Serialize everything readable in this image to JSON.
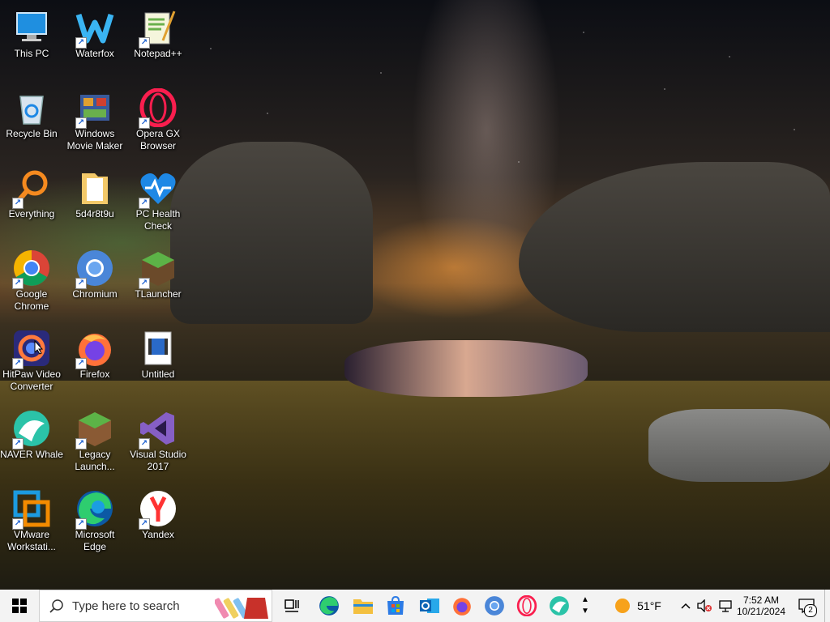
{
  "desktop": {
    "icons": [
      {
        "label": "This PC",
        "icon": "this-pc-icon",
        "shortcut": false
      },
      {
        "label": "Waterfox",
        "icon": "waterfox-icon",
        "shortcut": true
      },
      {
        "label": "Notepad++",
        "icon": "notepad-plus-plus-icon",
        "shortcut": true
      },
      {
        "label": "Recycle Bin",
        "icon": "recycle-bin-icon",
        "shortcut": false
      },
      {
        "label": "Windows Movie Maker",
        "icon": "movie-maker-icon",
        "shortcut": true
      },
      {
        "label": "Opera GX Browser",
        "icon": "opera-gx-icon",
        "shortcut": true
      },
      {
        "label": "Everything",
        "icon": "everything-search-icon",
        "shortcut": true
      },
      {
        "label": "5d4r8t9u",
        "icon": "folder-icon",
        "shortcut": false
      },
      {
        "label": "PC Health Check",
        "icon": "pc-health-check-icon",
        "shortcut": true
      },
      {
        "label": "Google Chrome",
        "icon": "chrome-icon",
        "shortcut": true
      },
      {
        "label": "Chromium",
        "icon": "chromium-icon",
        "shortcut": true
      },
      {
        "label": "TLauncher",
        "icon": "tlauncher-icon",
        "shortcut": true
      },
      {
        "label": "HitPaw Video Converter",
        "icon": "hitpaw-icon",
        "shortcut": true
      },
      {
        "label": "Firefox",
        "icon": "firefox-icon",
        "shortcut": true
      },
      {
        "label": "Untitled",
        "icon": "video-file-icon",
        "shortcut": false
      },
      {
        "label": "NAVER Whale",
        "icon": "naver-whale-icon",
        "shortcut": true
      },
      {
        "label": "Legacy Launch...",
        "icon": "legacy-launcher-icon",
        "shortcut": true
      },
      {
        "label": "Visual Studio 2017",
        "icon": "visual-studio-icon",
        "shortcut": true
      },
      {
        "label": "VMware Workstati...",
        "icon": "vmware-icon",
        "shortcut": true
      },
      {
        "label": "Microsoft Edge",
        "icon": "edge-icon",
        "shortcut": true
      },
      {
        "label": "Yandex",
        "icon": "yandex-icon",
        "shortcut": true
      }
    ]
  },
  "taskbar": {
    "search_placeholder": "Type here to search",
    "pinned": [
      "task-view-icon",
      "edge-icon",
      "file-explorer-icon",
      "microsoft-store-icon",
      "outlook-icon",
      "firefox-icon",
      "chromium-icon",
      "opera-icon",
      "naver-whale-icon"
    ],
    "weather": {
      "temp": "51°F"
    },
    "clock": {
      "time": "7:52 AM",
      "date": "10/21/2024"
    },
    "notifications_count": "2"
  }
}
